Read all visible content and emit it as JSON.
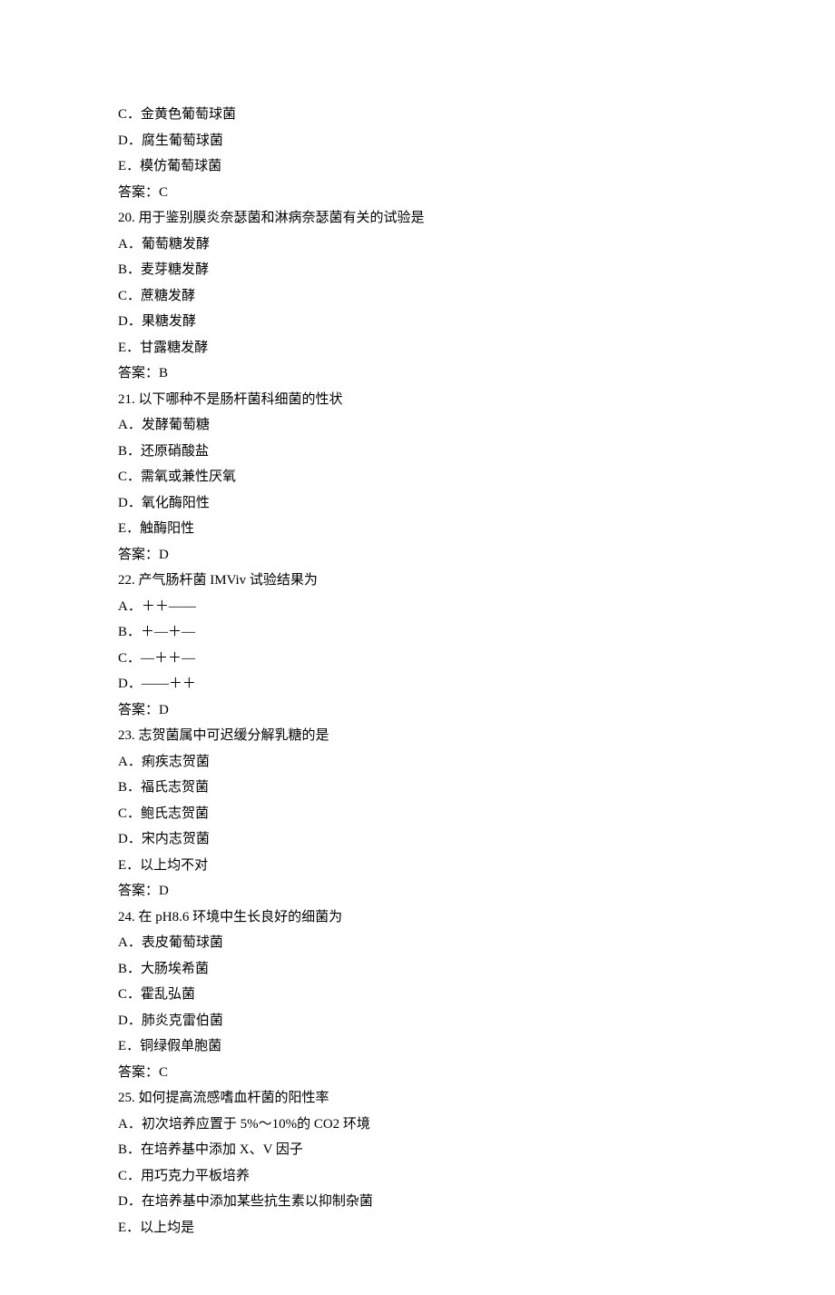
{
  "lines": [
    "C．金黄色葡萄球菌",
    "D．腐生葡萄球菌",
    "E．模仿葡萄球菌",
    "答案：C",
    "20. 用于鉴别膜炎奈瑟菌和淋病奈瑟菌有关的试验是",
    "A．葡萄糖发酵",
    "B．麦芽糖发酵",
    "C．蔗糖发酵",
    "D．果糖发酵",
    "E．甘露糖发酵",
    "答案：B",
    "21. 以下哪种不是肠杆菌科细菌的性状",
    "A．发酵葡萄糖",
    "B．还原硝酸盐",
    "C．需氧或兼性厌氧",
    "D．氧化酶阳性",
    "E．触酶阳性",
    "答案：D",
    "22. 产气肠杆菌 IMViv 试验结果为",
    "A．＋＋――",
    "B．＋―＋―",
    "C．―＋＋―",
    "D．――＋＋",
    "答案：D",
    "23. 志贺菌属中可迟缓分解乳糖的是",
    "A．痢疾志贺菌",
    "B．福氏志贺菌",
    "C．鲍氏志贺菌",
    "D．宋内志贺菌",
    "E．以上均不对",
    "答案：D",
    "24. 在 pH8.6 环境中生长良好的细菌为",
    "A．表皮葡萄球菌",
    "B．大肠埃希菌",
    "C．霍乱弘菌",
    "D．肺炎克雷伯菌",
    "E．铜绿假单胞菌",
    "答案：C",
    "25. 如何提高流感嗜血杆菌的阳性率",
    "A．初次培养应置于 5%～10%的 CO2 环境",
    "B．在培养基中添加 X、V 因子",
    "C．用巧克力平板培养",
    "D．在培养基中添加某些抗生素以抑制杂菌",
    "E．以上均是"
  ]
}
